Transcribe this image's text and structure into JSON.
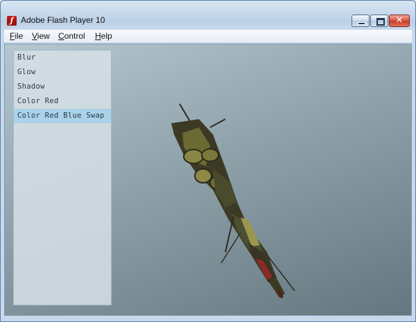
{
  "window": {
    "title": "Adobe Flash Player 10",
    "logo_glyph": "ƒ",
    "close_glyph": "✕"
  },
  "menubar": {
    "items": [
      {
        "label_first": "F",
        "label_rest": "ile"
      },
      {
        "label_first": "V",
        "label_rest": "iew"
      },
      {
        "label_first": "C",
        "label_rest": "ontrol"
      },
      {
        "label_first": "H",
        "label_rest": "elp"
      }
    ]
  },
  "filters": {
    "items": [
      {
        "label": "Blur"
      },
      {
        "label": "Glow"
      },
      {
        "label": "Shadow"
      },
      {
        "label": "Color Red"
      },
      {
        "label": "Color Red Blue Swap"
      }
    ],
    "selected": "Color Red Blue Swap"
  },
  "colors": {
    "selection": "#a9d3ea",
    "close_button": "#c33a24"
  }
}
